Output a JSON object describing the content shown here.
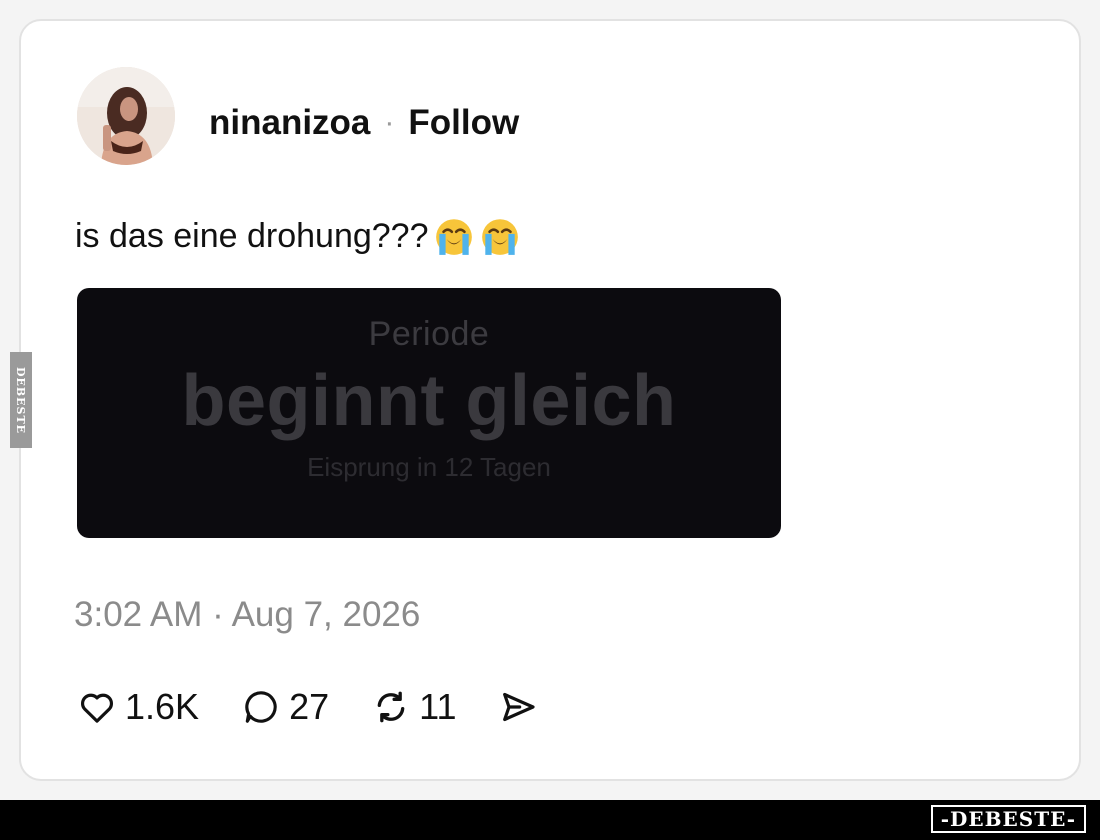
{
  "post": {
    "username": "ninanizoa",
    "separator": "·",
    "follow_label": "Follow",
    "text": "is das eine drohung???",
    "emojis": [
      "loudly-crying-face-emoji",
      "loudly-crying-face-emoji"
    ],
    "media": {
      "top_line": "Periode",
      "main_line": "beginnt gleich",
      "sub_line": "Eisprung in 12 Tagen"
    },
    "timestamp": "3:02 AM · Aug 7, 2026",
    "actions": {
      "like_count": "1.6K",
      "reply_count": "27",
      "repost_count": "11"
    }
  },
  "watermark": {
    "bottom_logo": "-DEBESTE-",
    "side_logo": "DEBESTE"
  },
  "colors": {
    "media_background": "#0c0b0f",
    "timestamp": "#8b8b8b",
    "card_border": "#e2e2e2"
  }
}
